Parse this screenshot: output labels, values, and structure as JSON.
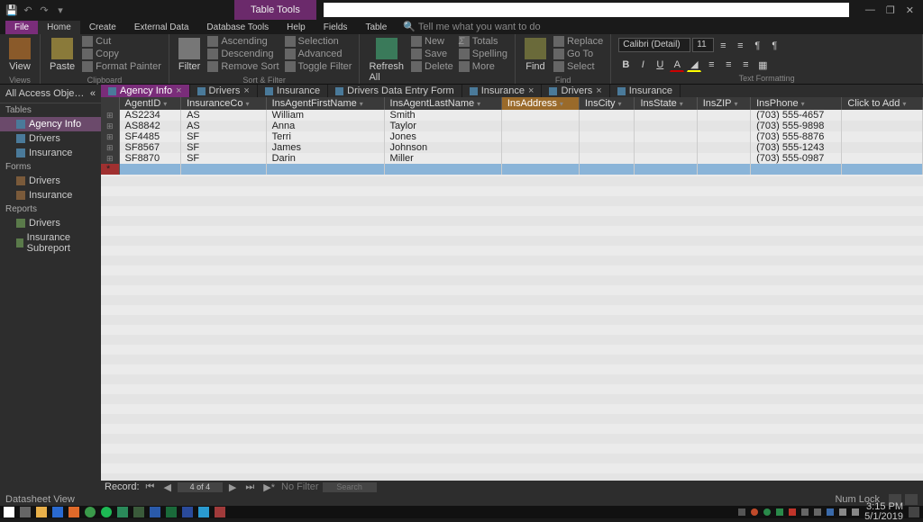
{
  "title_context": "Table Tools",
  "win_buttons": {
    "min": "—",
    "max": "❐",
    "close": "✕"
  },
  "qat": {
    "save": "💾",
    "undo": "↶",
    "redo": "↷"
  },
  "ribbon_tabs": [
    "File",
    "Home",
    "Create",
    "External Data",
    "Database Tools",
    "Help",
    "Fields",
    "Table"
  ],
  "active_ribbon_tab": "Home",
  "tell_me": "Tell me what you want to do",
  "ribbon": {
    "views": {
      "label": "Views",
      "btn": "View"
    },
    "clipboard": {
      "label": "Clipboard",
      "paste": "Paste",
      "cut": "Cut",
      "copy": "Copy",
      "painter": "Format Painter"
    },
    "sort": {
      "label": "Sort & Filter",
      "filter": "Filter",
      "asc": "Ascending",
      "desc": "Descending",
      "remove": "Remove Sort",
      "sel": "Selection",
      "adv": "Advanced",
      "tog": "Toggle Filter"
    },
    "records": {
      "label": "Records",
      "refresh": "Refresh\nAll",
      "new": "New",
      "save": "Save",
      "delete": "Delete",
      "totals": "Totals",
      "spell": "Spelling",
      "more": "More"
    },
    "find": {
      "label": "Find",
      "find": "Find",
      "replace": "Replace",
      "goto": "Go To",
      "select": "Select"
    },
    "text": {
      "label": "Text Formatting",
      "font": "Calibri (Detail)",
      "size": "11"
    }
  },
  "nav": {
    "header": "All Access Obje…",
    "sections": [
      {
        "name": "Tables",
        "items": [
          {
            "label": "Agency Info",
            "sel": true
          },
          {
            "label": "Drivers"
          },
          {
            "label": "Insurance"
          }
        ]
      },
      {
        "name": "Forms",
        "items": [
          {
            "label": "Drivers"
          },
          {
            "label": "Insurance"
          }
        ]
      },
      {
        "name": "Reports",
        "items": [
          {
            "label": "Drivers"
          },
          {
            "label": "Insurance Subreport"
          }
        ]
      }
    ]
  },
  "doc_tabs": [
    {
      "label": "Agency Info",
      "active": true,
      "closable": true
    },
    {
      "label": "Drivers",
      "closable": true
    },
    {
      "label": "Insurance"
    },
    {
      "label": "Drivers Data Entry Form"
    },
    {
      "label": "Insurance",
      "closable": true
    },
    {
      "label": "Drivers",
      "closable": true
    },
    {
      "label": "Insurance"
    }
  ],
  "columns": [
    "AgentID",
    "InsuranceCo",
    "InsAgentFirstName",
    "InsAgentLastName",
    "InsAddress",
    "InsCity",
    "InsState",
    "InsZIP",
    "InsPhone",
    "Click to Add"
  ],
  "selected_col": "InsAddress",
  "rows": [
    {
      "AgentID": "AS2234",
      "InsuranceCo": "AS",
      "InsAgentFirstName": "William",
      "InsAgentLastName": "Smith",
      "InsPhone": "(703) 555-4657"
    },
    {
      "AgentID": "AS8842",
      "InsuranceCo": "AS",
      "InsAgentFirstName": "Anna",
      "InsAgentLastName": "Taylor",
      "InsPhone": "(703) 555-9898"
    },
    {
      "AgentID": "SF4485",
      "InsuranceCo": "SF",
      "InsAgentFirstName": "Terri",
      "InsAgentLastName": "Jones",
      "InsPhone": "(703) 555-8876"
    },
    {
      "AgentID": "SF8567",
      "InsuranceCo": "SF",
      "InsAgentFirstName": "James",
      "InsAgentLastName": "Johnson",
      "InsPhone": "(703) 555-1243"
    },
    {
      "AgentID": "SF8870",
      "InsuranceCo": "SF",
      "InsAgentFirstName": "Darin",
      "InsAgentLastName": "Miller",
      "InsPhone": "(703) 555-0987"
    }
  ],
  "record_nav": {
    "label": "Record:",
    "pos": "4 of 4",
    "nofilter": "No Filter",
    "search": "Search"
  },
  "status": {
    "left": "Datasheet View",
    "right": "Num Lock"
  },
  "taskbar": {
    "time": "3:15 PM",
    "date": "5/1/2019"
  }
}
